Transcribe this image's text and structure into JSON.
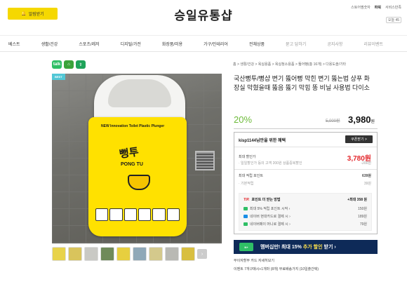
{
  "header": {
    "notify_label": "알림받기",
    "logo": "승일유통샵",
    "util": [
      "스토어찜숫자",
      "파워",
      "서비스만족"
    ],
    "recent_label": "오늘 45"
  },
  "gnb": [
    {
      "label": "베스트",
      "dim": false
    },
    {
      "label": "생활/건강",
      "dim": false
    },
    {
      "label": "스포츠/레저",
      "dim": false
    },
    {
      "label": "디지털/가전",
      "dim": false
    },
    {
      "label": "화장품/미용",
      "dim": false
    },
    {
      "label": "가구/인테리어",
      "dim": false
    },
    {
      "label": "전체상품",
      "dim": false
    },
    {
      "label": "묻고 답하기",
      "dim": true
    },
    {
      "label": "공지사항",
      "dim": true
    },
    {
      "label": "리뷰이벤트",
      "dim": true
    }
  ],
  "breadcrumb": "홈 > 생활/건강 > 욕실용품 > 욕실청소용품 > 뚫어뻥(총 16개) > 다용도솔/기타",
  "product": {
    "badge": "BEST",
    "sheet_headline": "NEW Innovation Toilet Plastic Plunger",
    "sheet_title": "뻥투",
    "sheet_sub": "PONG TU",
    "title": "국산뻥투/뻥샵 변기 뚫어뻥 막힌 변기 뚫는법 샹푸 화장실 막혔을때 뚫음 뚫기 막힘 똥 비닐 사용법 다이소",
    "discount_rate": "20%",
    "original_price": "5,000원",
    "price": "3,980",
    "price_unit": "원"
  },
  "benefit": {
    "heading": "kisp1144님만을 위한 혜택",
    "coupon_button": "쿠폰받기 >",
    "max_discount_label": "최대 할인가",
    "max_discount_note": "· 일일할인가 등의 고객 200원 상품중복할인",
    "max_discount_price": "3,780원",
    "max_discount_diff": "-200원",
    "point_label": "최대 적립 포인트",
    "point_value": "639원",
    "basic_point_label": "· 기본적립",
    "basic_point_value": "39원",
    "tip_title": "포인트 더 받는 방법",
    "tip_max": "+최대 358 원",
    "tips": [
      {
        "text": "최대 5% 적립 포인트 시작 ›",
        "value": "150원",
        "color": "#2fbf66"
      },
      {
        "text": "네이버 현대카드로 결제 시 ›",
        "value": "189원",
        "color": "#1a8ee6"
      },
      {
        "text": "네이버페이 머니로 결제 시 ›",
        "value": "79원",
        "color": "#2fbf66"
      }
    ]
  },
  "member_banner": {
    "prefix": "멤버십만! 최대 15%",
    "highlight": "추가 할인",
    "suffix": "받기 ›"
  },
  "info": {
    "payment": "무이자할부   카드 자세히보기",
    "shipping": "이벤트   7개구매시+1개마 (8개) 무료배송가지 (10일출간택)"
  },
  "colors": {
    "notify": "#f5d800",
    "discount": "#6dbb3a",
    "price_red": "#e3262b",
    "member_bg": "#0e2a58",
    "sheet": "#ffe100"
  }
}
